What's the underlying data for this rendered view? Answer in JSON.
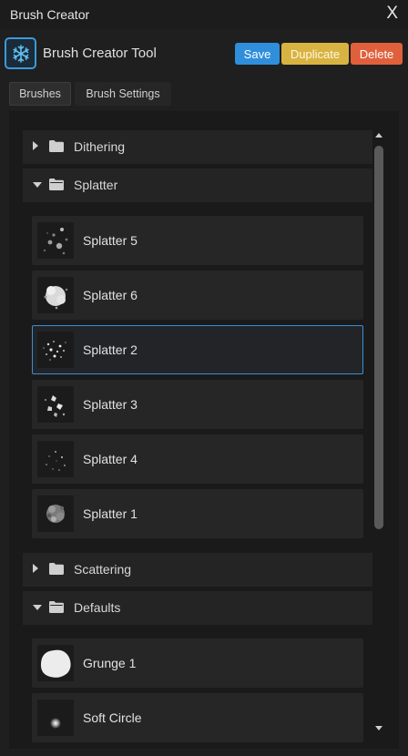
{
  "window": {
    "title": "Brush Creator",
    "close_label": "X"
  },
  "header": {
    "app_title": "Brush Creator Tool",
    "logo_icon": "snowflake-icon",
    "buttons": {
      "save": "Save",
      "duplicate": "Duplicate",
      "delete": "Delete"
    },
    "colors": {
      "save": "#2f8fdc",
      "duplicate": "#d8b341",
      "delete": "#e0603c",
      "accent": "#3b8fd6"
    }
  },
  "tabs": [
    {
      "label": "Brushes",
      "active": true
    },
    {
      "label": "Brush Settings",
      "active": false
    }
  ],
  "folders": [
    {
      "name": "Dithering",
      "expanded": false,
      "items": []
    },
    {
      "name": "Splatter",
      "expanded": true,
      "items": [
        {
          "name": "Splatter 5",
          "selected": false
        },
        {
          "name": "Splatter 6",
          "selected": false
        },
        {
          "name": "Splatter 2",
          "selected": true
        },
        {
          "name": "Splatter 3",
          "selected": false
        },
        {
          "name": "Splatter 4",
          "selected": false
        },
        {
          "name": "Splatter 1",
          "selected": false
        }
      ]
    },
    {
      "name": "Scattering",
      "expanded": false,
      "items": []
    },
    {
      "name": "Defaults",
      "expanded": true,
      "items": [
        {
          "name": "Grunge 1",
          "selected": false
        },
        {
          "name": "Soft Circle",
          "selected": false
        }
      ]
    }
  ]
}
